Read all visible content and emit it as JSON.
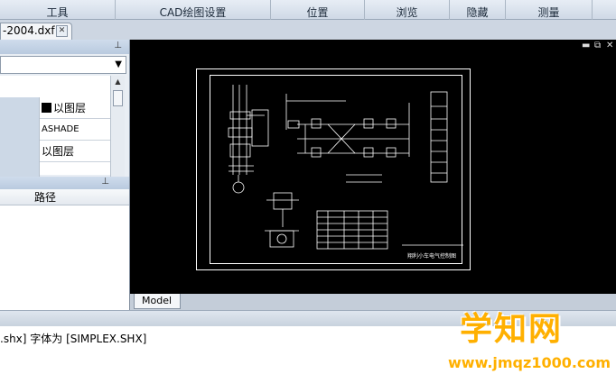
{
  "ribbon": {
    "groups": [
      {
        "label": "工具"
      },
      {
        "label": "CAD绘图设置"
      },
      {
        "label": "位置"
      },
      {
        "label": "浏览"
      },
      {
        "label": "隐藏"
      },
      {
        "label": "测量"
      }
    ]
  },
  "document_tab": {
    "label": "-2004.dxf",
    "close_icon": "close-icon"
  },
  "properties_panel": {
    "pin_icon": "pin-icon",
    "combo_arrow_icon": "chevron-down-icon",
    "rows": [
      {
        "value": "以图层",
        "swatch": "#000000"
      },
      {
        "value": "ASHADE"
      },
      {
        "value": "以图层"
      }
    ]
  },
  "paths_panel": {
    "pin_icon": "pin-icon",
    "column_header": "路径"
  },
  "canvas": {
    "background": "#000000",
    "window_controls": [
      "minimize-icon",
      "restore-icon",
      "close-icon"
    ],
    "title_block_text": "翔利小车电气控制图"
  },
  "model_tab": {
    "label": "Model"
  },
  "command_line": {
    "text": ".shx] 字体为 [SIMPLEX.SHX]"
  },
  "watermark": {
    "logo": "学知网",
    "url": "www.jmqz1000.com"
  }
}
